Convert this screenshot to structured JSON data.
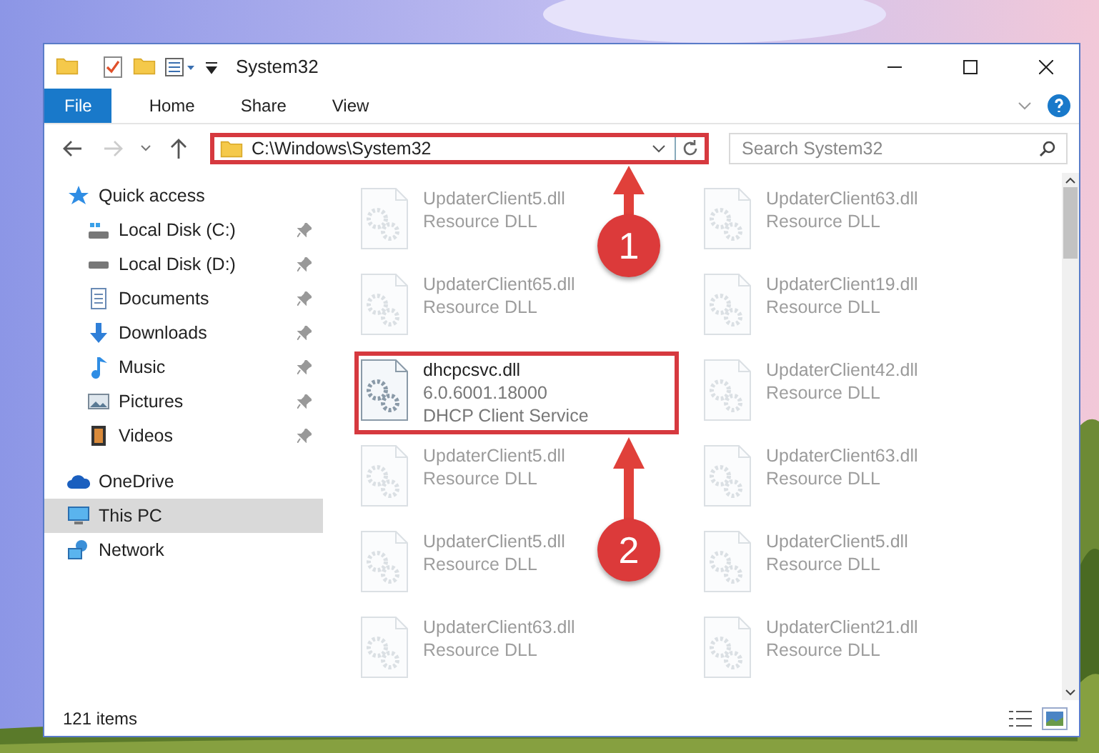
{
  "window": {
    "title": "System32"
  },
  "ribbon_tabs": [
    {
      "label": "File",
      "kind": "file"
    },
    {
      "label": "Home",
      "kind": "tab",
      "selected": false
    },
    {
      "label": "Share",
      "kind": "tab",
      "selected": false
    },
    {
      "label": "View",
      "kind": "tab",
      "selected": false
    }
  ],
  "address": {
    "path": "C:\\Windows\\System32",
    "highlighted": true
  },
  "search": {
    "placeholder": "Search System32"
  },
  "sidebar": {
    "items": [
      {
        "label": "Quick access",
        "kind": "star",
        "pinned": false,
        "selected": false,
        "section": true
      },
      {
        "label": "Local Disk (C:)",
        "kind": "disk-c",
        "pinned": true,
        "selected": false,
        "section": false
      },
      {
        "label": "Local Disk (D:)",
        "kind": "disk",
        "pinned": true,
        "selected": false,
        "section": false
      },
      {
        "label": "Documents",
        "kind": "documents",
        "pinned": true,
        "selected": false,
        "section": false
      },
      {
        "label": "Downloads",
        "kind": "downloads",
        "pinned": true,
        "selected": false,
        "section": false
      },
      {
        "label": "Music",
        "kind": "music",
        "pinned": true,
        "selected": false,
        "section": false
      },
      {
        "label": "Pictures",
        "kind": "pictures",
        "pinned": true,
        "selected": false,
        "section": false
      },
      {
        "label": "Videos",
        "kind": "videos",
        "pinned": true,
        "selected": false,
        "section": false
      },
      {
        "label": "OneDrive",
        "kind": "cloud",
        "pinned": false,
        "selected": false,
        "section": true
      },
      {
        "label": "This PC",
        "kind": "pc",
        "pinned": false,
        "selected": true,
        "section": true
      },
      {
        "label": "Network",
        "kind": "network",
        "pinned": false,
        "selected": false,
        "section": true
      }
    ]
  },
  "files": [
    {
      "name": "UpdaterClient5.dll",
      "details": [
        "Resource DLL"
      ],
      "dimmed": true,
      "highlighted": false
    },
    {
      "name": "UpdaterClient63.dll",
      "details": [
        "Resource DLL"
      ],
      "dimmed": true,
      "highlighted": false
    },
    {
      "name": "UpdaterClient65.dll",
      "details": [
        "Resource DLL"
      ],
      "dimmed": true,
      "highlighted": false
    },
    {
      "name": "UpdaterClient19.dll",
      "details": [
        "Resource DLL"
      ],
      "dimmed": true,
      "highlighted": false
    },
    {
      "name": "dhcpcsvc.dll",
      "details": [
        "6.0.6001.18000",
        "DHCP Client Service"
      ],
      "dimmed": false,
      "highlighted": true
    },
    {
      "name": "UpdaterClient42.dll",
      "details": [
        "Resource DLL"
      ],
      "dimmed": true,
      "highlighted": false
    },
    {
      "name": "UpdaterClient5.dll",
      "details": [
        "Resource DLL"
      ],
      "dimmed": true,
      "highlighted": false
    },
    {
      "name": "UpdaterClient63.dll",
      "details": [
        "Resource DLL"
      ],
      "dimmed": true,
      "highlighted": false
    },
    {
      "name": "UpdaterClient5.dll",
      "details": [
        "Resource DLL"
      ],
      "dimmed": true,
      "highlighted": false
    },
    {
      "name": "UpdaterClient5.dll",
      "details": [
        "Resource DLL"
      ],
      "dimmed": true,
      "highlighted": false
    },
    {
      "name": "UpdaterClient63.dll",
      "details": [
        "Resource DLL"
      ],
      "dimmed": true,
      "highlighted": false
    },
    {
      "name": "UpdaterClient21.dll",
      "details": [
        "Resource DLL"
      ],
      "dimmed": true,
      "highlighted": false
    }
  ],
  "status_bar": {
    "item_count": "121 items"
  },
  "annotations": [
    {
      "number": "1"
    },
    {
      "number": "2"
    }
  ]
}
